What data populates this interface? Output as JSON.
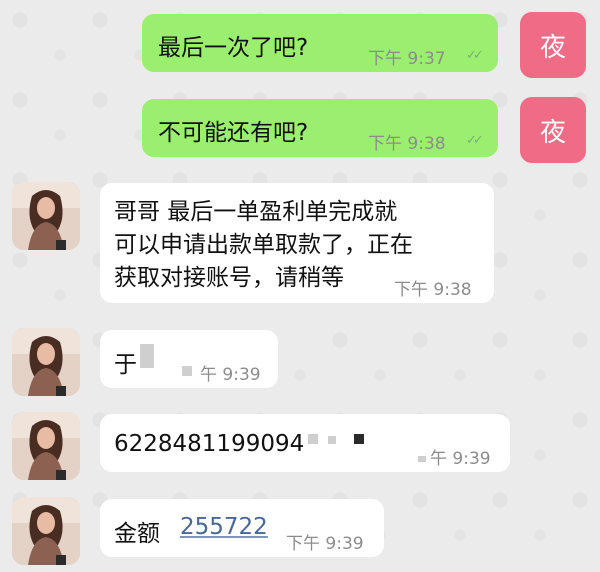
{
  "chat": {
    "messages": [
      {
        "id": "m1",
        "side": "out",
        "avatar_label": "夜",
        "text": "最后一次了吧?",
        "time": "下午 9:37",
        "ticks": "✓✓"
      },
      {
        "id": "m2",
        "side": "out",
        "avatar_label": "夜",
        "text": "不可能还有吧?",
        "time": "下午 9:38",
        "ticks": "✓✓"
      },
      {
        "id": "m3",
        "side": "in",
        "lines": [
          "哥哥  最后一单盈利单完成就",
          "可以申请出款单取款了，正在",
          "获取对接账号，请稍等"
        ],
        "time": "下午 9:38"
      },
      {
        "id": "m4",
        "side": "in",
        "text": "于",
        "time": "午 9:39"
      },
      {
        "id": "m5",
        "side": "in",
        "text": "6228481199094",
        "time": "午 9:39"
      },
      {
        "id": "m6",
        "side": "in",
        "label": "金额",
        "amount": "255722",
        "time": "下午 9:39"
      }
    ]
  },
  "colors": {
    "outgoing_bubble": "#9bef6e",
    "incoming_bubble": "#ffffff",
    "self_avatar": "#f06b85",
    "timestamp": "#8c8c8c",
    "link": "#4a6896",
    "background": "#ebebeb"
  },
  "icons": {
    "read_receipt": "double-check-icon",
    "other_avatar": "user-avatar-photo"
  }
}
